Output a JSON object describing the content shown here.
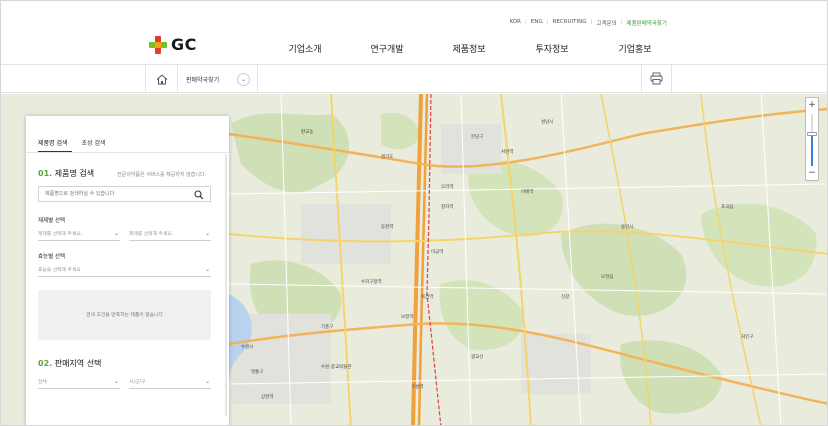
{
  "utility_nav": {
    "items": [
      "KOR",
      "ENG",
      "RECRUITING",
      "고객문의"
    ],
    "highlight": "제품판매약국찾기"
  },
  "brand": {
    "logo_text": "GC"
  },
  "nav": {
    "items": [
      "기업소개",
      "연구개발",
      "제품정보",
      "투자정보",
      "기업홍보"
    ]
  },
  "breadcrumb": {
    "label": "판매약국찾기"
  },
  "panel": {
    "tabs": [
      "제품명 검색",
      "초성 검색"
    ],
    "section1": {
      "number": "01.",
      "title": "제품명 검색",
      "note": "전문의약품은 서비스를 제공하지 않습니다."
    },
    "search": {
      "placeholder": "제품명으로 검색하실 수 있습니다"
    },
    "form_field": {
      "label": "제제별 선택",
      "select1": "제제를 선택해 주세요.",
      "select2": "제제를 선택해 주세요."
    },
    "effect_field": {
      "label": "효능별 선택",
      "select": "효능을 선택해 주세요"
    },
    "empty_message": "검색 조건을 만족하는 제품이 없습니다",
    "section2": {
      "number": "02.",
      "title": "판매지역 선택"
    },
    "region": {
      "select1": "전체",
      "select2": "시/군/구"
    }
  },
  "map": {
    "labels": [
      "분당구",
      "성남시",
      "판교동",
      "오리역",
      "수지구청역",
      "광교산",
      "용인시",
      "경기도",
      "기흥구",
      "구성역",
      "동천역",
      "미금역",
      "정자역",
      "서현역",
      "이매역",
      "신갈",
      "상현역",
      "수원시",
      "영통구",
      "죽전역",
      "보정역",
      "수원 광교박물관",
      "모현읍",
      "포곡읍",
      "처인구"
    ],
    "zoom_level": 0.6
  },
  "colors": {
    "accent_green": "#5aa83a",
    "logo_green": "#7bbf26",
    "logo_red": "#e23b2f",
    "logo_orange": "#f2a11a",
    "zoom_blue": "#3b7de0"
  }
}
